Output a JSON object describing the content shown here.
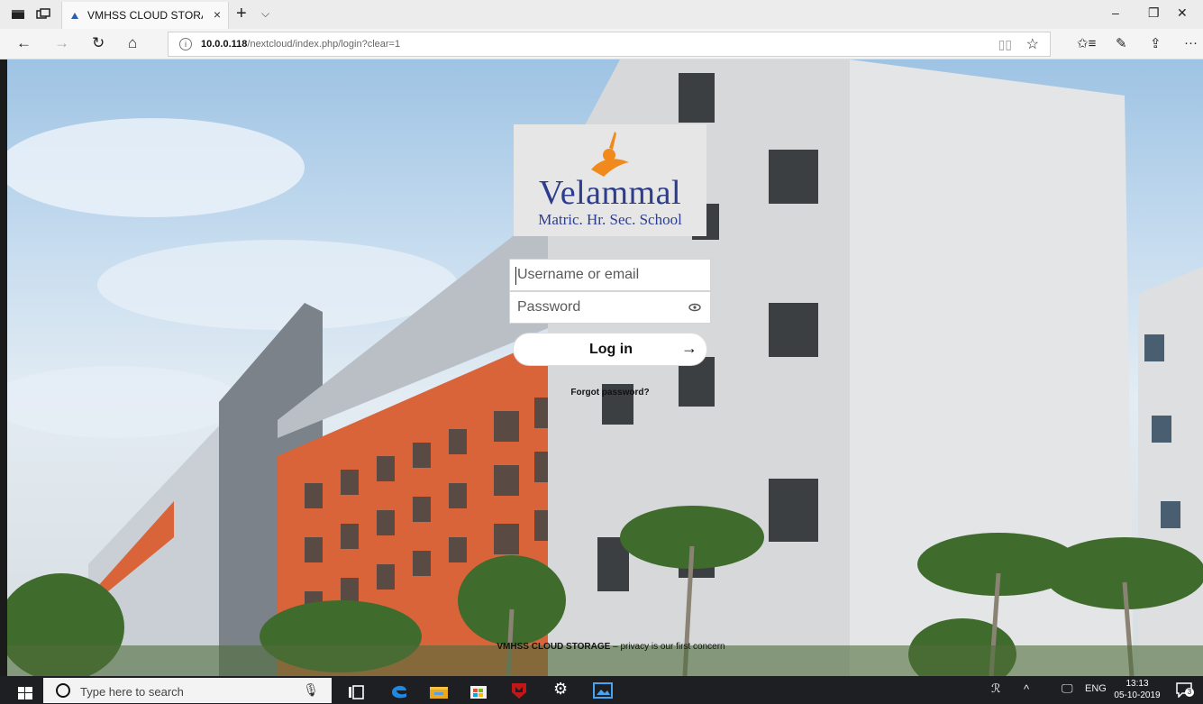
{
  "browser": {
    "tab_title": "VMHSS CLOUD STORAC",
    "tab_close": "×",
    "new_tab": "+",
    "tab_menu": "⌵",
    "url_host": "10.0.0.118",
    "url_path": "/nextcloud/index.php/login?clear=1",
    "info_glyph": "i",
    "window": {
      "minimize": "–",
      "maximize": "❐",
      "close": "✕"
    }
  },
  "nav": {
    "back": "←",
    "forward": "→",
    "refresh": "↻",
    "home": "⌂",
    "reading": "📖",
    "favorite": "☆",
    "favorites_hub": "✩≡",
    "notes": "✎",
    "share": "⇪",
    "more": "···"
  },
  "login": {
    "brand": "Velammal",
    "brand_sub": "Matric. Hr. Sec. School",
    "username_placeholder": "Username or email",
    "password_placeholder": "Password",
    "login_label": "Log in",
    "login_arrow": "→",
    "forgot": "Forgot password?",
    "footer_brand": "VMHSS CLOUD STORAGE",
    "footer_rest": " – privacy is our first concern"
  },
  "taskbar": {
    "search_placeholder": "Type here to search",
    "mic": "🎙",
    "people": "ℛ",
    "chevron": "^",
    "network": "🖵",
    "language": "ENG",
    "time": "13:13",
    "date": "05-10-2019",
    "notifications": "3"
  },
  "colors": {
    "brand_blue": "#2d3d8e",
    "orange_wall": "#d9643a",
    "taskbar": "#1e1f22"
  }
}
